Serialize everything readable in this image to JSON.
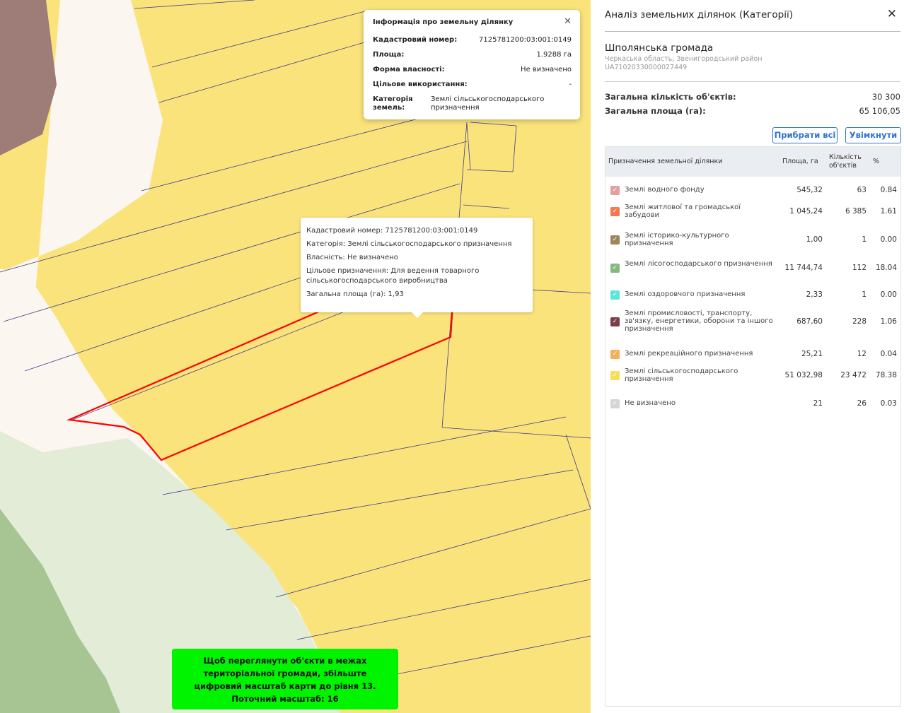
{
  "info_card": {
    "title": "Інформація про земельну ділянку",
    "rows": [
      {
        "label": "Кадастровий номер:",
        "value": "7125781200:03:001:0149"
      },
      {
        "label": "Площа:",
        "value": "1.9288 га"
      },
      {
        "label": "Форма власності:",
        "value": "Не визначено"
      },
      {
        "label": "Цільове використання:",
        "value": "-"
      }
    ],
    "category_label": "Категорія земель:",
    "category_value": "Землі сільськогосподарського призначення"
  },
  "tooltip": {
    "cadastral": "Кадастровий номер: 7125781200:03:001:0149",
    "category": "Категорія: Землі сільськогосподарського призначення",
    "ownership": "Власність: Не визначено",
    "purpose": "Цільове призначення: Для ведення товарного сільськогосподарського виробництва",
    "area": "Загальна площа (га): 1,93"
  },
  "zoom_banner": {
    "line1": "Щоб переглянути об'єкти в межах",
    "line2": "територіальної громади, збільште",
    "line3": "цифровий масштаб карти до рівня 13.",
    "line4": "Поточний масштаб: 16"
  },
  "panel": {
    "title": "Аналіз земельних ділянок (Категорії)",
    "hromada": "Шполянська громада",
    "region": "Черкаська область, Звенигородський район",
    "code": "UA71020330000027449",
    "total_count_label": "Загальна кількість об'єктів:",
    "total_count_value": "30 300",
    "total_area_label": "Загальна площа (га):",
    "total_area_value": "65 106,05",
    "btn_remove_all": "Прибрати всі",
    "btn_enable": "Увімкнути",
    "table_headers": {
      "purpose": "Призначення земельної ділянки",
      "area": "Площа, га",
      "count_line1": "Кількість",
      "count_line2": "об'єктів",
      "pct": "%"
    },
    "rows": [
      {
        "name": "Землі водного фонду",
        "area": "545,32",
        "count": "63",
        "pct": "0.84",
        "color": "#e3a0a0"
      },
      {
        "name": "Землі житлової та громадської забудови",
        "area": "1 045,24",
        "count": "6 385",
        "pct": "1.61",
        "color": "#f27a4f"
      },
      {
        "name": "Землі історико-культурного призначення",
        "area": "1,00",
        "count": "1",
        "pct": "0.00",
        "color": "#a0855c"
      },
      {
        "name": "Землі лісогосподарського призначення",
        "area": "11 744,74",
        "count": "112",
        "pct": "18.04",
        "color": "#86b97d"
      },
      {
        "name": "Землі оздоровчого призначення",
        "area": "2,33",
        "count": "1",
        "pct": "0.00",
        "color": "#5de6d8"
      },
      {
        "name": "Землі промисловості, транспорту, зв'язку, енергетики, оборони та іншого призначення",
        "area": "687,60",
        "count": "228",
        "pct": "1.06",
        "color": "#7a3e47"
      },
      {
        "name": "Землі рекреаційного призначення",
        "area": "25,21",
        "count": "12",
        "pct": "0.04",
        "color": "#f4b05c"
      },
      {
        "name": "Землі сільськогосподарського призначення",
        "area": "51 032,98",
        "count": "23 472",
        "pct": "78.38",
        "color": "#f5df57"
      },
      {
        "name": "Не визначено",
        "area": "21",
        "count": "26",
        "pct": "0.03",
        "color": "#d5d5d5"
      }
    ]
  },
  "colors": {
    "map_yellow": "#fbe37b",
    "road": "#fbf7f0",
    "forest_light": "#e2ecd6",
    "forest_dark": "#a7c593",
    "residential": "#9e7c77",
    "selected_outline": "#ff0000",
    "accent": "#2e73d8",
    "banner": "#00f400"
  }
}
